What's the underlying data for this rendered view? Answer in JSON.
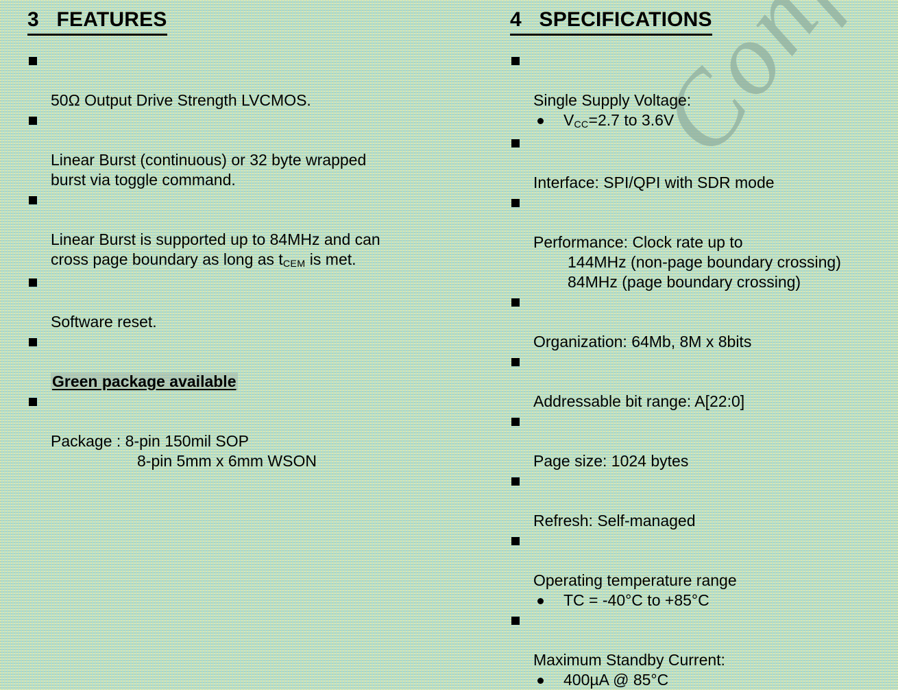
{
  "background": {
    "color": "#b6d7c3",
    "texture": "dithered-halftone"
  },
  "watermark": {
    "text": "Confidential",
    "color": "#8fae9e",
    "rotation_deg": -52
  },
  "features": {
    "heading": {
      "number": "3",
      "title": "FEATURES",
      "full": "3   FEATURES"
    },
    "items": [
      {
        "bullet": "square",
        "text": "50Ω Output Drive Strength LVCMOS."
      },
      {
        "bullet": "square",
        "text": "Linear Burst (continuous) or 32 byte wrapped\nburst via toggle command."
      },
      {
        "bullet": "square",
        "text_part_1": "Linear Burst is supported up to 84MHz and can\ncross page boundary as long as t",
        "subscript": "CEM",
        "text_part_2": " is met."
      },
      {
        "bullet": "square",
        "text": "Software reset."
      },
      {
        "bullet": "square",
        "text": "Green package available",
        "style": "bold-underline-highlight"
      },
      {
        "bullet": "square",
        "text": "Package : 8-pin 150mil SOP",
        "continuation": "8-pin 5mm x 6mm WSON"
      }
    ]
  },
  "specifications": {
    "heading": {
      "number": "4",
      "title": "SPECIFICATIONS",
      "full": "4   SPECIFICATIONS"
    },
    "items": [
      {
        "bullet": "square",
        "text": "Single Supply Voltage:"
      },
      {
        "bullet": "dot",
        "text_part_1": "V",
        "subscript": "CC",
        "text_part_2": "=2.7 to 3.6V"
      },
      {
        "bullet": "square",
        "text": "Interface: SPI/QPI with SDR mode"
      },
      {
        "bullet": "square",
        "text": "Performance: Clock rate up to",
        "continuation_1": "144MHz (non-page boundary crossing)",
        "continuation_2": "84MHz (page boundary crossing)"
      },
      {
        "bullet": "square",
        "text": "Organization: 64Mb, 8M x 8bits"
      },
      {
        "bullet": "square",
        "text": "Addressable bit range: A[22:0]"
      },
      {
        "bullet": "square",
        "text": "Page size: 1024 bytes"
      },
      {
        "bullet": "square",
        "text": "Refresh: Self-managed"
      },
      {
        "bullet": "square",
        "text": "Operating temperature range"
      },
      {
        "bullet": "dot",
        "text": "TC = -40°C to +85°C"
      },
      {
        "bullet": "square",
        "text": "Maximum Standby Current:"
      },
      {
        "bullet": "dot",
        "text": "400µA @ 85°C"
      }
    ]
  }
}
